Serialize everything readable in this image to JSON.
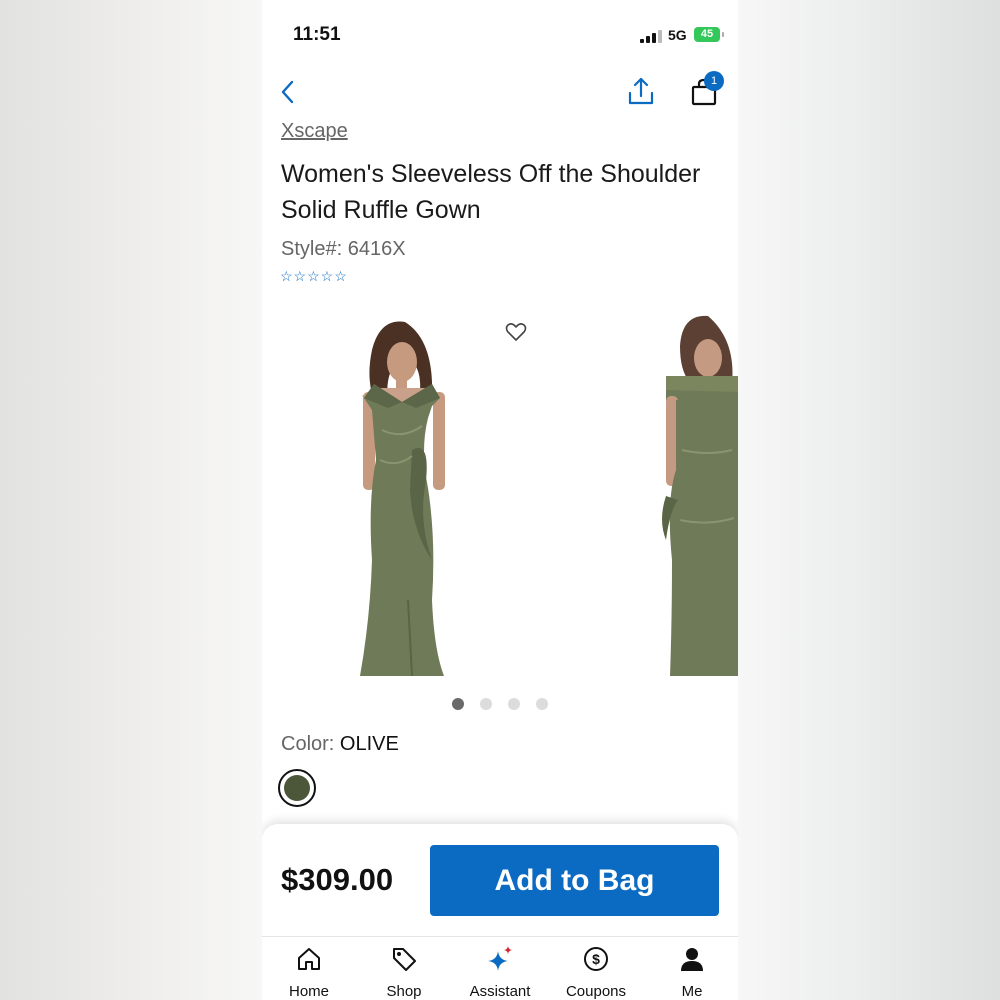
{
  "status_bar": {
    "time": "11:51",
    "network": "5G",
    "battery": "45"
  },
  "header": {
    "back_icon": "chevron-left-icon",
    "share_icon": "share-upload-icon",
    "bag_icon": "shopping-bag-icon",
    "bag_count": "1"
  },
  "product": {
    "brand": "Xscape",
    "title": "Women's Sleeveless Off the Shoulder Solid Ruffle Gown",
    "style": "Style#: 6416X",
    "rating_stars": "☆☆☆☆☆",
    "rating_value": 0,
    "color_label": "Color:",
    "color_value": "OLIVE",
    "color_hex": "#4b5738",
    "price": "$309.00"
  },
  "gallery": {
    "image_count": 4,
    "active_index": 0
  },
  "actions": {
    "add_to_bag": "Add to Bag"
  },
  "tabs": [
    {
      "label": "Home",
      "icon": "home-icon"
    },
    {
      "label": "Shop",
      "icon": "tag-icon"
    },
    {
      "label": "Assistant",
      "icon": "sparkle-icon"
    },
    {
      "label": "Coupons",
      "icon": "dollar-coupon-icon"
    },
    {
      "label": "Me",
      "icon": "user-icon"
    }
  ],
  "colors": {
    "accent": "#0b6bc2",
    "battery": "#34c759",
    "dress": "#6f7a58"
  }
}
